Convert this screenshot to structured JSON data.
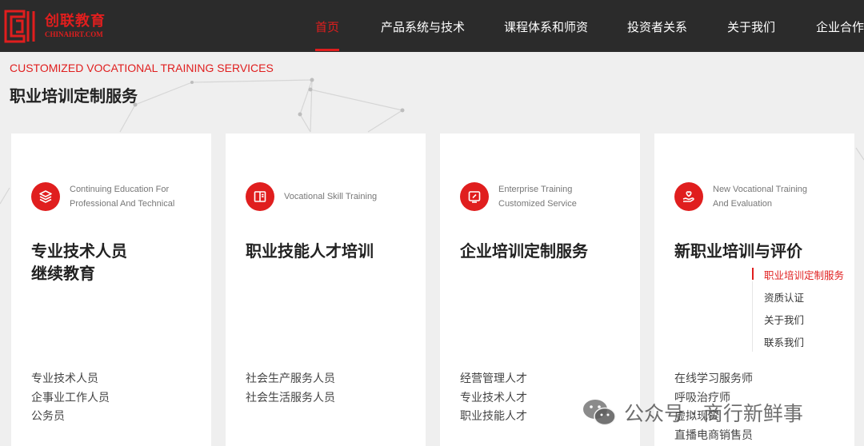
{
  "logo": {
    "cn": "创联教育",
    "en": "CHINAHRT.COM"
  },
  "nav": [
    {
      "label": "首页",
      "active": true
    },
    {
      "label": "产品系统与技术"
    },
    {
      "label": "课程体系和师资"
    },
    {
      "label": "投资者关系"
    },
    {
      "label": "关于我们"
    },
    {
      "label": "企业合作"
    }
  ],
  "section": {
    "title_en": "CUSTOMIZED VOCATIONAL TRAINING SERVICES",
    "title_cn": "职业培训定制服务"
  },
  "cards": [
    {
      "icon": "layers-icon",
      "subtitle_1": "Continuing Education For",
      "subtitle_2": "Professional And Technical",
      "title_1": "专业技术人员",
      "title_2": "继续教育",
      "items": [
        "专业技术人员",
        "企事业工作人员",
        "公务员"
      ]
    },
    {
      "icon": "book-icon",
      "subtitle_1": "Vocational Skill Training",
      "title_1": "职业技能人才培训",
      "items": [
        "社会生产服务人员",
        "社会生活服务人员"
      ]
    },
    {
      "icon": "monitor-icon",
      "subtitle_1": "Enterprise Training",
      "subtitle_2": "Customized Service",
      "title_1": "企业培训定制服务",
      "items": [
        "经营管理人才",
        "专业技术人才",
        "职业技能人才"
      ]
    },
    {
      "icon": "hand-heart-icon",
      "subtitle_1": "New Vocational Training",
      "subtitle_2": "And Evaluation",
      "title_1": "新职业培训与评价",
      "items": [
        "在线学习服务师",
        "呼吸治疗师",
        "虚拟现实",
        "直播电商销售员"
      ]
    }
  ],
  "side_menu": [
    {
      "label": "职业培训定制服务",
      "active": true
    },
    {
      "label": "资质认证"
    },
    {
      "label": "关于我们"
    },
    {
      "label": "联系我们"
    }
  ],
  "watermark": {
    "icon": "wechat-icon",
    "text": "公众号 · 商行新鲜事"
  },
  "colors": {
    "brand_red": "#e01e1e",
    "header_bg": "#2b2b2b",
    "page_bg": "#efefef"
  }
}
